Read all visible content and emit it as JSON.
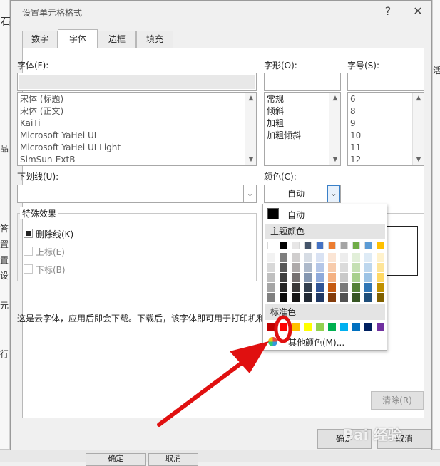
{
  "dialog": {
    "title": "设置单元格格式",
    "help_label": "?",
    "close_label": "✕"
  },
  "tabs": [
    {
      "label": "数字"
    },
    {
      "label": "字体"
    },
    {
      "label": "边框"
    },
    {
      "label": "填充"
    }
  ],
  "font": {
    "label": "字体(F):",
    "list": [
      "宋体 (标题)",
      "宋体 (正文)",
      "KaiTi",
      "Microsoft YaHei UI",
      "Microsoft YaHei UI Light",
      "SimSun-ExtB"
    ]
  },
  "style": {
    "label": "字形(O):",
    "list": [
      "常规",
      "倾斜",
      "加粗",
      "加粗倾斜"
    ]
  },
  "size": {
    "label": "字号(S):",
    "list": [
      "6",
      "8",
      "9",
      "10",
      "11",
      "12"
    ]
  },
  "underline": {
    "label": "下划线(U):"
  },
  "color": {
    "label": "颜色(C):",
    "value": "自动"
  },
  "effects": {
    "title": "特殊效果",
    "strikethrough": "删除线(K)",
    "superscript": "上标(E)",
    "subscript": "下标(B)"
  },
  "note": "这是云字体，应用后即会下载。下载后，该字体即可用于打印机和",
  "clear_button": "清除(R)",
  "ok_button": "确定",
  "cancel_button": "取消",
  "watermark": "Bai 经验",
  "background": {
    "left_chars": [
      "石",
      "品",
      "答",
      "置",
      "置",
      "设",
      "元",
      "行"
    ],
    "right_char": "活",
    "bottom_buttons": [
      "确定",
      "取消"
    ]
  },
  "color_popup": {
    "auto_label": "自动",
    "theme_header": "主题颜色",
    "standard_header": "标准色",
    "more_colors": "其他颜色(M)...",
    "theme_top": [
      "#ffffff",
      "#000000",
      "#e7e6e6",
      "#44546a",
      "#4472c4",
      "#ed7d31",
      "#a5a5a5",
      "#70ad47",
      "#5b9bd5",
      "#ffc000"
    ],
    "theme_shades": [
      [
        "#f2f2f2",
        "#d8d8d8",
        "#bfbfbf",
        "#a5a5a5",
        "#7f7f7f"
      ],
      [
        "#7f7f7f",
        "#595959",
        "#3f3f3f",
        "#262626",
        "#0c0c0c"
      ],
      [
        "#d0cece",
        "#aeaaaa",
        "#757070",
        "#3a3838",
        "#171616"
      ],
      [
        "#d6dce4",
        "#adb9ca",
        "#8496b0",
        "#333f4f",
        "#222a35"
      ],
      [
        "#d9e2f3",
        "#b4c6e7",
        "#8eaadb",
        "#2f5496",
        "#1f3864"
      ],
      [
        "#fbe5d5",
        "#f7cbac",
        "#f4b183",
        "#c55a11",
        "#833c0b"
      ],
      [
        "#ededed",
        "#dbdbdb",
        "#c9c9c9",
        "#7b7b7b",
        "#525252"
      ],
      [
        "#e2efd9",
        "#c5e0b3",
        "#a8d08d",
        "#538135",
        "#375623"
      ],
      [
        "#deebf6",
        "#bdd7ee",
        "#9cc3e5",
        "#2e75b5",
        "#1e4e79"
      ],
      [
        "#fff2cc",
        "#fee599",
        "#ffd965",
        "#bf9000",
        "#7f6000"
      ]
    ],
    "standard": [
      "#c00000",
      "#ff0000",
      "#ffc000",
      "#ffff00",
      "#92d050",
      "#00b050",
      "#00b0f0",
      "#0070c0",
      "#002060",
      "#7030a0"
    ]
  }
}
